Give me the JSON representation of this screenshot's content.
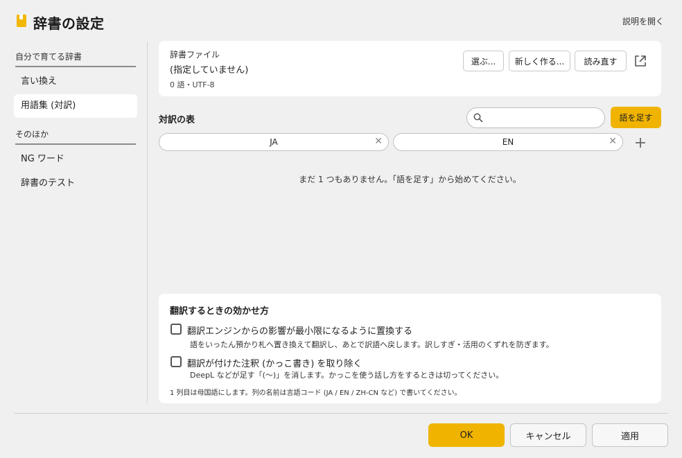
{
  "header": {
    "title": "辞書の設定",
    "help_link": "説明を開く"
  },
  "sidebar": {
    "sections": [
      {
        "title": "自分で育てる辞書",
        "items": [
          {
            "label": "言い換え"
          },
          {
            "label": "用語集 (対訳)"
          }
        ]
      },
      {
        "title": "そのほか",
        "items": [
          {
            "label": "NG ワード"
          },
          {
            "label": "辞書のテスト"
          }
        ]
      }
    ]
  },
  "file_card": {
    "label": "辞書ファイル",
    "value": "(指定していません)",
    "meta": "0 語・UTF-8",
    "choose_label": "選ぶ...",
    "new_label": "新しく作る...",
    "reload_label": "読み直す"
  },
  "table": {
    "title": "対訳の表",
    "search_placeholder": "",
    "search_value": "",
    "add_term_label": "語を足す",
    "columns": [
      "JA",
      "EN"
    ],
    "empty_message": "まだ 1 つもありません。「語を足す」から始めてください。"
  },
  "options": {
    "title": "翻訳するときの効かせ方",
    "items": [
      {
        "label": "翻訳エンジンからの影響が最小限になるように置換する",
        "description": "語をいったん預かり札へ置き換えて翻訳し、あとで訳語へ戻します。訳しすぎ・活用のくずれを防ぎます。",
        "checked": false
      },
      {
        "label": "翻訳が付けた注釈 (かっこ書き) を取り除く",
        "description": "DeepL などが足す「(〜)」を消します。かっこを使う話し方をするときは切ってください。",
        "checked": false
      }
    ],
    "note": "1 列目は母国語にします。列の名前は言語コード (JA / EN / ZH-CN など) で書いてください。"
  },
  "footer": {
    "ok_label": "OK",
    "cancel_label": "キャンセル",
    "apply_label": "適用"
  },
  "colors": {
    "accent": "#f0b400",
    "background": "#f0f0f0",
    "card": "#ffffff"
  }
}
